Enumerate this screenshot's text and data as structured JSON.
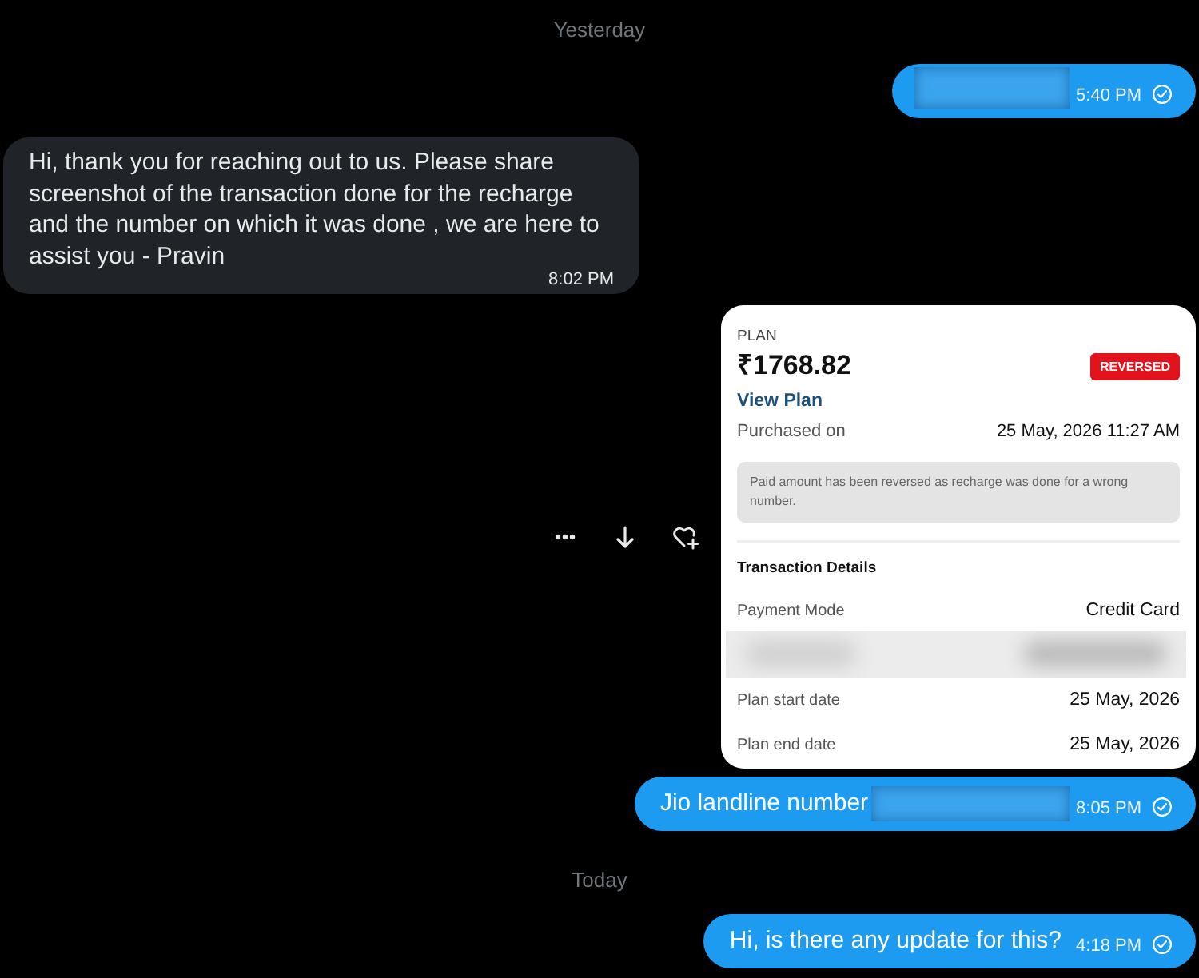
{
  "messages": [
    {
      "kind": "date",
      "text": "Yesterday"
    },
    {
      "kind": "sent",
      "redacted": true,
      "time": "5:40 PM"
    },
    {
      "kind": "received",
      "text": "Hi, thank you for reaching out to us. Please share screenshot of the transaction done for the recharge and the number on which it was done , we are here to assist you - Pravin",
      "time": "8:02 PM"
    },
    {
      "kind": "image",
      "receipt": {
        "label": "PLAN",
        "amount": "₹1768.82",
        "badge": "REVERSED",
        "link": "View Plan",
        "purchased": {
          "label": "Purchased on",
          "value": "25 May, 2026 11:27 AM"
        },
        "note": "Paid amount has been reversed as recharge was done for a wrong number.",
        "section_title": "Transaction Details",
        "details": [
          {
            "kind": "field",
            "label": "Payment Mode",
            "value": "Credit Card"
          },
          {
            "kind": "redacted"
          },
          {
            "kind": "field",
            "label": "Plan start date",
            "value": "25 May, 2026"
          },
          {
            "kind": "field",
            "label": "Plan end date",
            "value": "25 May, 2026"
          }
        ]
      }
    },
    {
      "kind": "sent",
      "text": "Jio landline number",
      "redacted": true,
      "time": "8:05 PM"
    },
    {
      "kind": "date",
      "text": "Today"
    },
    {
      "kind": "sent",
      "text": "Hi, is there any update for this?",
      "redacted": false,
      "time": "4:18 PM"
    }
  ]
}
